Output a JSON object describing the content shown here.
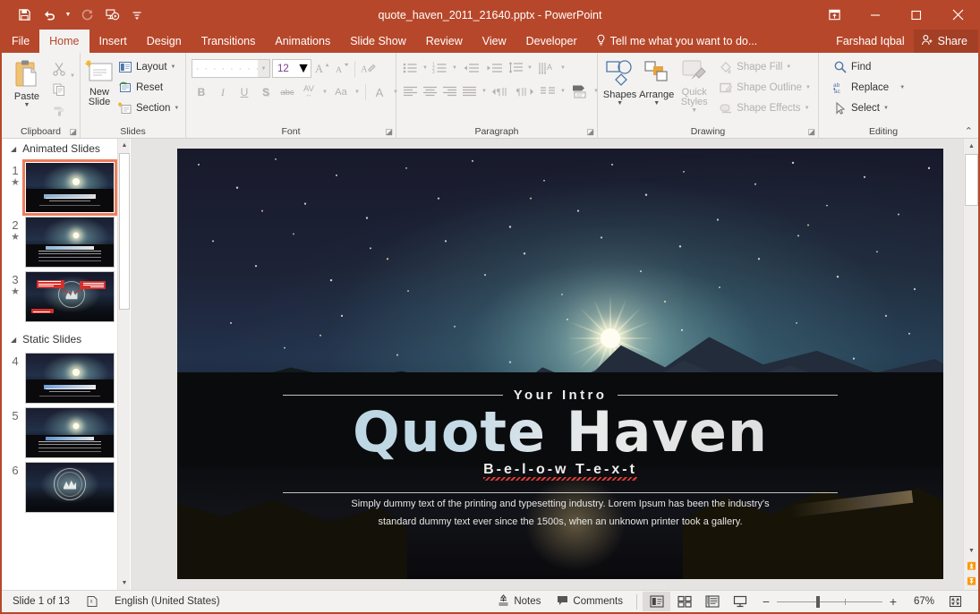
{
  "window": {
    "title": "quote_haven_2011_21640.pptx - PowerPoint",
    "qat": [
      {
        "name": "save-icon",
        "label": "Save"
      },
      {
        "name": "undo-icon",
        "label": "Undo"
      },
      {
        "name": "redo-icon",
        "label": "Redo"
      },
      {
        "name": "start-presentation-icon",
        "label": "Start From Beginning"
      },
      {
        "name": "customize-qat-icon",
        "label": "Customize Quick Access Toolbar"
      }
    ],
    "controls": {
      "ribbon_display": "Ribbon Display Options",
      "minimize": "Minimize",
      "restore": "Restore Down",
      "close": "Close"
    }
  },
  "tabs": [
    {
      "label": "File",
      "active": false
    },
    {
      "label": "Home",
      "active": true
    },
    {
      "label": "Insert",
      "active": false
    },
    {
      "label": "Design",
      "active": false
    },
    {
      "label": "Transitions",
      "active": false
    },
    {
      "label": "Animations",
      "active": false
    },
    {
      "label": "Slide Show",
      "active": false
    },
    {
      "label": "Review",
      "active": false
    },
    {
      "label": "View",
      "active": false
    },
    {
      "label": "Developer",
      "active": false
    }
  ],
  "tellme": "Tell me what you want to do...",
  "account": "Farshad Iqbal",
  "share": "Share",
  "ribbon": {
    "clipboard": {
      "group_label": "Clipboard",
      "paste": "Paste",
      "cut": "Cut",
      "copy": "Copy",
      "format_painter": "Format Painter"
    },
    "slides": {
      "group_label": "Slides",
      "new_slide": "New Slide",
      "layout": "Layout",
      "reset": "Reset",
      "section": "Section"
    },
    "font": {
      "group_label": "Font",
      "font_name": "",
      "font_size": "12",
      "grow": "Increase Font Size",
      "shrink": "Decrease Font Size",
      "clear_formatting": "Clear All Formatting",
      "bold": "B",
      "italic": "I",
      "underline": "U",
      "shadow": "S",
      "strikethrough": "abc",
      "char_spacing": "AV",
      "change_case": "Aa",
      "font_color": "A"
    },
    "paragraph": {
      "group_label": "Paragraph",
      "bullets": "Bullets",
      "numbering": "Numbering",
      "decrease_indent": "Decrease List Level",
      "increase_indent": "Increase List Level",
      "line_spacing": "Line Spacing",
      "text_direction": "Text Direction",
      "align_text": "Align Text",
      "convert_smartart": "Convert to SmartArt",
      "align_left": "Align Left",
      "align_center": "Center",
      "align_right": "Align Right",
      "justify": "Justify",
      "ltr": "Left-to-Right",
      "rtl": "Right-to-Left",
      "columns": "Columns"
    },
    "drawing": {
      "group_label": "Drawing",
      "shapes": "Shapes",
      "arrange": "Arrange",
      "quick_styles": "Quick Styles",
      "shape_fill": "Shape Fill",
      "shape_outline": "Shape Outline",
      "shape_effects": "Shape Effects"
    },
    "editing": {
      "group_label": "Editing",
      "find": "Find",
      "replace": "Replace",
      "select": "Select",
      "collapse": "Collapse the Ribbon"
    }
  },
  "thumbnails": {
    "sections": [
      {
        "title": "Animated Slides",
        "slides": [
          {
            "number": "1",
            "animated": true,
            "selected": true,
            "kind": "title"
          },
          {
            "number": "2",
            "animated": true,
            "selected": false,
            "kind": "lines"
          },
          {
            "number": "3",
            "animated": true,
            "selected": false,
            "kind": "diagram"
          }
        ]
      },
      {
        "title": "Static Slides",
        "slides": [
          {
            "number": "4",
            "animated": false,
            "selected": false,
            "kind": "title"
          },
          {
            "number": "5",
            "animated": false,
            "selected": false,
            "kind": "lines"
          },
          {
            "number": "6",
            "animated": false,
            "selected": false,
            "kind": "badge"
          }
        ]
      }
    ]
  },
  "slide": {
    "intro": "Your Intro",
    "title": "Quote Haven",
    "below": "B-e-l-o-w  T-e-x-t",
    "body": "Simply dummy text of the printing and typesetting industry. Lorem Ipsum has been the industry's standard dummy text ever since the 1500s, when an unknown printer took a gallery."
  },
  "status": {
    "slide_counter": "Slide 1 of 13",
    "language": "English (United States)",
    "notes": "Notes",
    "comments": "Comments",
    "views": [
      {
        "name": "normal-view",
        "label": "Normal",
        "active": true
      },
      {
        "name": "slide-sorter-view",
        "label": "Slide Sorter",
        "active": false
      },
      {
        "name": "reading-view",
        "label": "Reading View",
        "active": false
      },
      {
        "name": "slide-show-view",
        "label": "Slide Show",
        "active": false
      }
    ],
    "zoom_out": "−",
    "zoom_in": "+",
    "zoom_level": "67%",
    "fit_to_window": "Fit slide to current window"
  }
}
